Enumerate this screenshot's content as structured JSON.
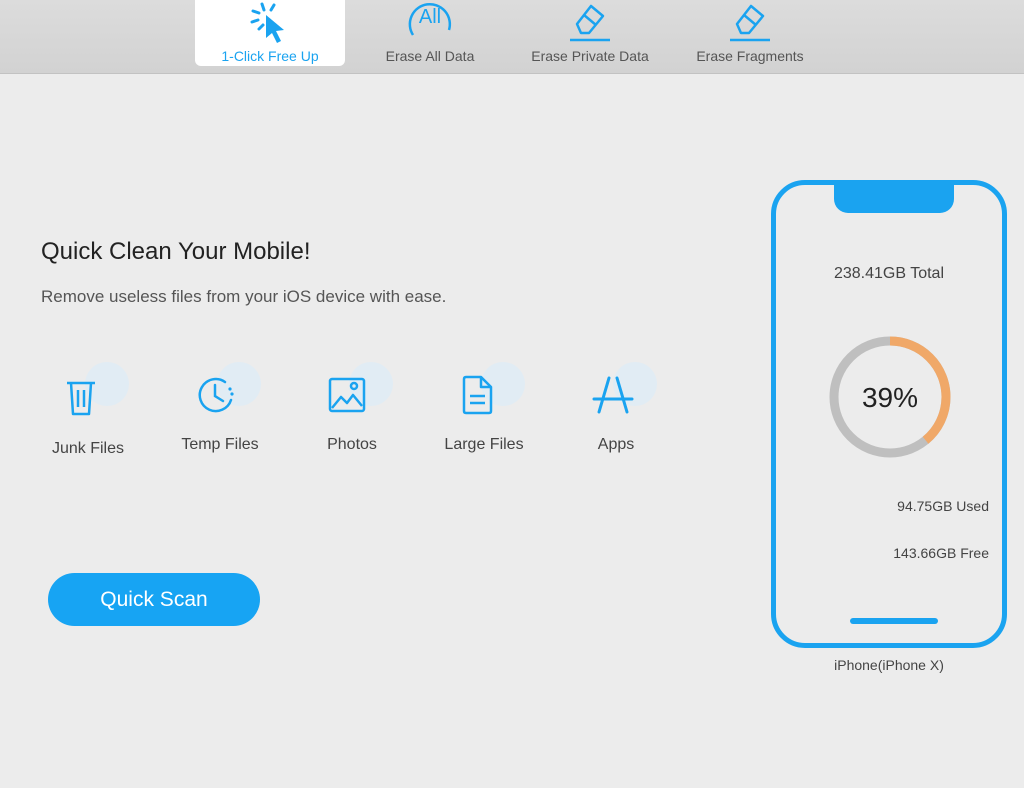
{
  "toolbar": {
    "tabs": [
      {
        "label": "1-Click Free Up",
        "icon": "cursor-click-icon",
        "active": true
      },
      {
        "label": "Erase All Data",
        "icon": "all-icon",
        "active": false
      },
      {
        "label": "Erase Private Data",
        "icon": "eraser-icon",
        "active": false
      },
      {
        "label": "Erase Fragments",
        "icon": "eraser-icon",
        "active": false
      }
    ],
    "all_icon_text": "All"
  },
  "main": {
    "headline": "Quick Clean Your Mobile!",
    "subline": "Remove useless files from your iOS device with ease.",
    "categories": [
      {
        "label": "Junk Files",
        "icon": "trash-icon"
      },
      {
        "label": "Temp Files",
        "icon": "clock-icon"
      },
      {
        "label": "Photos",
        "icon": "image-icon"
      },
      {
        "label": "Large Files",
        "icon": "file-icon"
      },
      {
        "label": "Apps",
        "icon": "app-store-icon"
      }
    ],
    "scan_button": "Quick Scan"
  },
  "device": {
    "total": "238.41GB Total",
    "percent_label": "39%",
    "used_fraction": 0.39,
    "used": "94.75GB Used",
    "free": "143.66GB Free",
    "name": "iPhone(iPhone X)"
  },
  "colors": {
    "accent": "#1aa3f0",
    "used_arc": "#f0a868",
    "free_arc": "#bfbfbf"
  }
}
